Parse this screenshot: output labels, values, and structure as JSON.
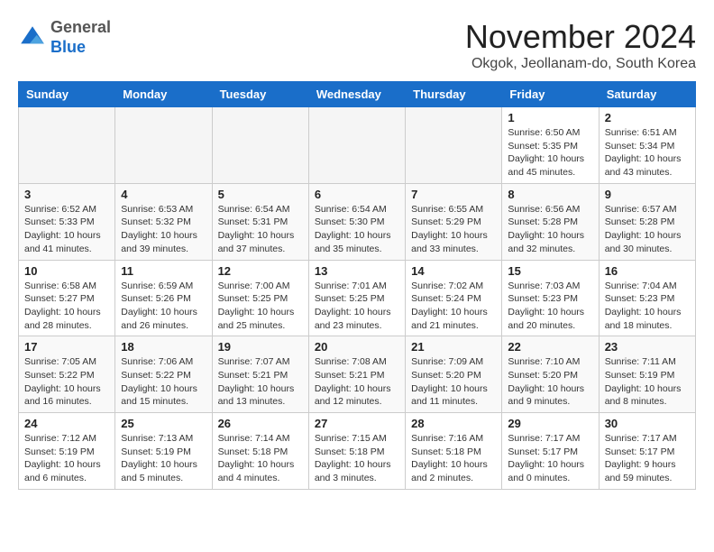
{
  "logo": {
    "general": "General",
    "blue": "Blue"
  },
  "title": "November 2024",
  "location": "Okgok, Jeollanam-do, South Korea",
  "days_of_week": [
    "Sunday",
    "Monday",
    "Tuesday",
    "Wednesday",
    "Thursday",
    "Friday",
    "Saturday"
  ],
  "weeks": [
    [
      {
        "num": "",
        "empty": true
      },
      {
        "num": "",
        "empty": true
      },
      {
        "num": "",
        "empty": true
      },
      {
        "num": "",
        "empty": true
      },
      {
        "num": "",
        "empty": true
      },
      {
        "num": "1",
        "sunrise": "6:50 AM",
        "sunset": "5:35 PM",
        "daylight": "10 hours and 45 minutes."
      },
      {
        "num": "2",
        "sunrise": "6:51 AM",
        "sunset": "5:34 PM",
        "daylight": "10 hours and 43 minutes."
      }
    ],
    [
      {
        "num": "3",
        "sunrise": "6:52 AM",
        "sunset": "5:33 PM",
        "daylight": "10 hours and 41 minutes."
      },
      {
        "num": "4",
        "sunrise": "6:53 AM",
        "sunset": "5:32 PM",
        "daylight": "10 hours and 39 minutes."
      },
      {
        "num": "5",
        "sunrise": "6:54 AM",
        "sunset": "5:31 PM",
        "daylight": "10 hours and 37 minutes."
      },
      {
        "num": "6",
        "sunrise": "6:54 AM",
        "sunset": "5:30 PM",
        "daylight": "10 hours and 35 minutes."
      },
      {
        "num": "7",
        "sunrise": "6:55 AM",
        "sunset": "5:29 PM",
        "daylight": "10 hours and 33 minutes."
      },
      {
        "num": "8",
        "sunrise": "6:56 AM",
        "sunset": "5:28 PM",
        "daylight": "10 hours and 32 minutes."
      },
      {
        "num": "9",
        "sunrise": "6:57 AM",
        "sunset": "5:28 PM",
        "daylight": "10 hours and 30 minutes."
      }
    ],
    [
      {
        "num": "10",
        "sunrise": "6:58 AM",
        "sunset": "5:27 PM",
        "daylight": "10 hours and 28 minutes."
      },
      {
        "num": "11",
        "sunrise": "6:59 AM",
        "sunset": "5:26 PM",
        "daylight": "10 hours and 26 minutes."
      },
      {
        "num": "12",
        "sunrise": "7:00 AM",
        "sunset": "5:25 PM",
        "daylight": "10 hours and 25 minutes."
      },
      {
        "num": "13",
        "sunrise": "7:01 AM",
        "sunset": "5:25 PM",
        "daylight": "10 hours and 23 minutes."
      },
      {
        "num": "14",
        "sunrise": "7:02 AM",
        "sunset": "5:24 PM",
        "daylight": "10 hours and 21 minutes."
      },
      {
        "num": "15",
        "sunrise": "7:03 AM",
        "sunset": "5:23 PM",
        "daylight": "10 hours and 20 minutes."
      },
      {
        "num": "16",
        "sunrise": "7:04 AM",
        "sunset": "5:23 PM",
        "daylight": "10 hours and 18 minutes."
      }
    ],
    [
      {
        "num": "17",
        "sunrise": "7:05 AM",
        "sunset": "5:22 PM",
        "daylight": "10 hours and 16 minutes."
      },
      {
        "num": "18",
        "sunrise": "7:06 AM",
        "sunset": "5:22 PM",
        "daylight": "10 hours and 15 minutes."
      },
      {
        "num": "19",
        "sunrise": "7:07 AM",
        "sunset": "5:21 PM",
        "daylight": "10 hours and 13 minutes."
      },
      {
        "num": "20",
        "sunrise": "7:08 AM",
        "sunset": "5:21 PM",
        "daylight": "10 hours and 12 minutes."
      },
      {
        "num": "21",
        "sunrise": "7:09 AM",
        "sunset": "5:20 PM",
        "daylight": "10 hours and 11 minutes."
      },
      {
        "num": "22",
        "sunrise": "7:10 AM",
        "sunset": "5:20 PM",
        "daylight": "10 hours and 9 minutes."
      },
      {
        "num": "23",
        "sunrise": "7:11 AM",
        "sunset": "5:19 PM",
        "daylight": "10 hours and 8 minutes."
      }
    ],
    [
      {
        "num": "24",
        "sunrise": "7:12 AM",
        "sunset": "5:19 PM",
        "daylight": "10 hours and 6 minutes."
      },
      {
        "num": "25",
        "sunrise": "7:13 AM",
        "sunset": "5:19 PM",
        "daylight": "10 hours and 5 minutes."
      },
      {
        "num": "26",
        "sunrise": "7:14 AM",
        "sunset": "5:18 PM",
        "daylight": "10 hours and 4 minutes."
      },
      {
        "num": "27",
        "sunrise": "7:15 AM",
        "sunset": "5:18 PM",
        "daylight": "10 hours and 3 minutes."
      },
      {
        "num": "28",
        "sunrise": "7:16 AM",
        "sunset": "5:18 PM",
        "daylight": "10 hours and 2 minutes."
      },
      {
        "num": "29",
        "sunrise": "7:17 AM",
        "sunset": "5:17 PM",
        "daylight": "10 hours and 0 minutes."
      },
      {
        "num": "30",
        "sunrise": "7:17 AM",
        "sunset": "5:17 PM",
        "daylight": "9 hours and 59 minutes."
      }
    ]
  ]
}
